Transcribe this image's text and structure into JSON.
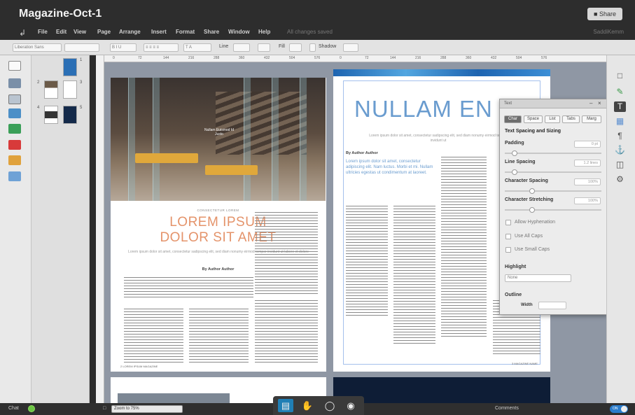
{
  "app": {
    "title": "Magazine-Oct-1",
    "share_label": "Share"
  },
  "menu": {
    "items": [
      "File",
      "Edit",
      "View",
      "Page",
      "Arrange",
      "Insert",
      "Format",
      "Share",
      "Window",
      "Help"
    ],
    "save_status": "All changes saved",
    "user": "SaddiKemm"
  },
  "toolbar": {
    "font_family": "Liberation Sans",
    "line_label": "Line",
    "fill_label": "Fill",
    "shadow_label": "Shadow"
  },
  "thumbnails": {
    "page_numbers": [
      "1",
      "2",
      "3",
      "4",
      "5"
    ]
  },
  "ruler": {
    "ticks": [
      "0",
      "72",
      "144",
      "216",
      "288",
      "360",
      "432",
      "504",
      "576",
      "0",
      "72",
      "144",
      "216",
      "288",
      "360",
      "432",
      "504",
      "576"
    ]
  },
  "left_page": {
    "photo_caption": "Nullam Euismod Id Justo",
    "kicker": "CONSECTETUR LOREM",
    "headline_1": "LOREM IPSUM",
    "headline_2": "DOLOR SIT AMET",
    "subline": "Lorem ipsum dolor sit amet, consectetur sadipscing elit, sed diam nonumy eirmod tempor invidunt ut labore et dolore",
    "byline": "By Author Author",
    "footer": "2 LOREM IPSUM MAGAZINE"
  },
  "right_page": {
    "headline": "NULLAM EN",
    "subline": "Lorem ipsum dolor sit amet, consectetur sadipscing elit, sed diam nonumy eirmod tempor invidunt ut",
    "byline": "By Author Author",
    "lead": "Lorem ipsum dolor sit amet, consectetur adipiscing elit. Nam luctus. Morbi et mi. Nullam ultricies egestas ut condimentum at laoreet.",
    "footer": "3 MAGAZINE NAME"
  },
  "text_panel": {
    "title": "Text",
    "tabs": [
      "Char",
      "Space",
      "List",
      "Tabs",
      "Marg"
    ],
    "section_title": "Text Spacing and Sizing",
    "padding_label": "Padding",
    "padding_value": "0 pt",
    "line_spacing_label": "Line Spacing",
    "line_spacing_value": "1.2 lines",
    "char_spacing_label": "Character Spacing",
    "char_spacing_value": "100%",
    "char_stretch_label": "Character Stretching",
    "char_stretch_value": "100%",
    "allow_hyphenation": "Allow Hyphenation",
    "use_all_caps": "Use All Caps",
    "use_small_caps": "Use Small Caps",
    "highlight_label": "Highlight",
    "highlight_value": "None",
    "outline_label": "Outline",
    "width_label": "Width"
  },
  "bottom": {
    "chat_label": "Chat",
    "zoom_label": "Zoom to 75%",
    "comments_label": "Comments",
    "toggle_label": "ON"
  },
  "colors": {
    "accent_blue": "#207fb5",
    "headline_orange": "#e4936a",
    "headline_blue": "#6a9ccf",
    "chat_online": "#6cc644"
  }
}
